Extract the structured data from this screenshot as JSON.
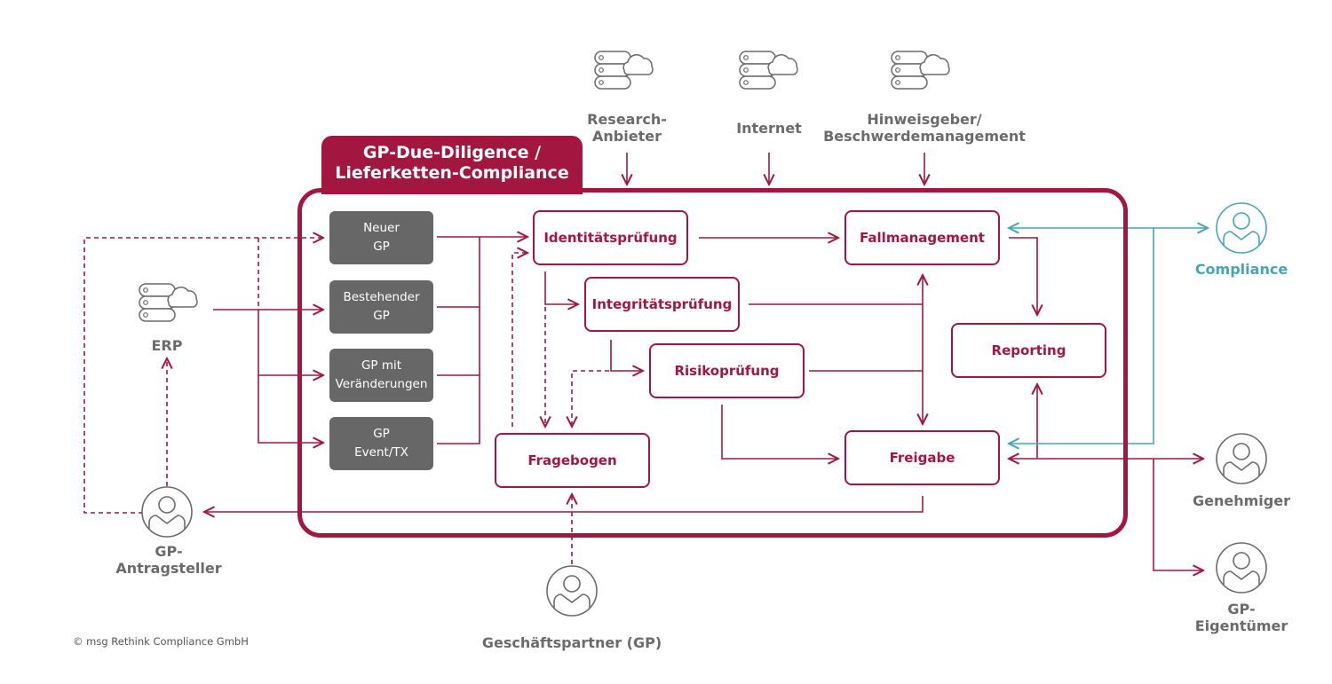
{
  "title": "GP-Due-Diligence / Lieferketten-Compliance",
  "title_lines": [
    "GP-Due-Diligence /",
    "Lieferketten-Compliance"
  ],
  "colors": {
    "brand": "#a3163f",
    "gray_box": "#676767",
    "label_gray": "#6b6b6b",
    "compliance_teal": "#4aa3b8"
  },
  "sources": [
    {
      "label": "Research-\nAnbieter",
      "icon": "server-cloud-icon"
    },
    {
      "label": "Internet",
      "icon": "server-cloud-icon"
    },
    {
      "label": "Hinweisgeber/\nBeschwerdemanagement",
      "icon": "server-cloud-icon"
    }
  ],
  "erp": {
    "label": "ERP",
    "icon": "server-cloud-icon"
  },
  "inputs": [
    {
      "label": "Neuer\nGP"
    },
    {
      "label": "Bestehender\nGP"
    },
    {
      "label": "GP mit\nVeränderungen"
    },
    {
      "label": "GP\nEvent/TX"
    }
  ],
  "steps": {
    "identitaet": "Identitätsprüfung",
    "integritaet": "Integritätsprüfung",
    "risiko": "Risikoprüfung",
    "fragebogen": "Fragebogen",
    "fallmanagement": "Fallmanagement",
    "reporting": "Reporting",
    "freigabe": "Freigabe"
  },
  "actors": {
    "antragsteller": "GP-\nAntragsteller",
    "geschaeftspartner": "Geschäftspartner (GP)",
    "compliance": "Compliance",
    "genehmiger": "Genehmiger",
    "eigentuemer": "GP-\nEigentümer"
  },
  "footer": {
    "copyright": "© msg Rethink Compliance GmbH"
  }
}
